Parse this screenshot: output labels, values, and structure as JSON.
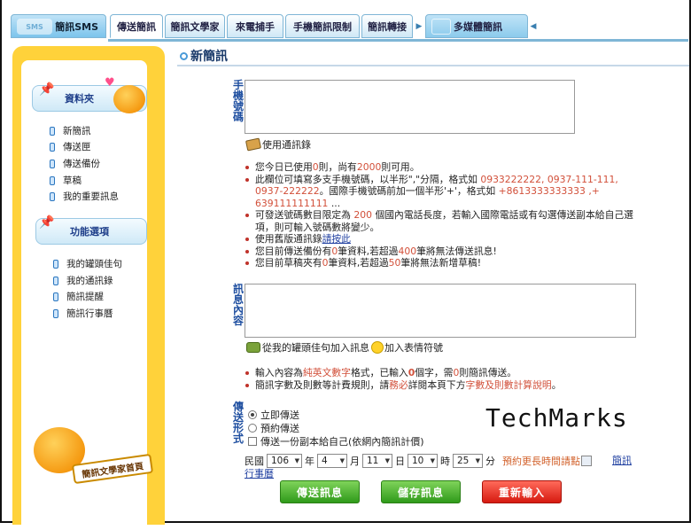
{
  "tabs": {
    "sms": "簡訊SMS",
    "sms_logo": "SMS",
    "items": [
      "傳送簡訊",
      "簡訊文學家",
      "來電捕手",
      "手機簡訊限制",
      "簡訊轉接"
    ],
    "mms": "多媒體簡訊"
  },
  "sidebar": {
    "folder_title": "資料夾",
    "folder_items": [
      "新簡訊",
      "傳送匣",
      "傳送備份",
      "草稿",
      "我的重要訊息"
    ],
    "options_title": "功能選項",
    "option_items": [
      "我的罐頭佳句",
      "我的通訊錄",
      "簡訊提醒",
      "簡訊行事曆"
    ],
    "badge": "簡訊文學家首頁"
  },
  "page": {
    "title": "新簡訊"
  },
  "phone": {
    "label": "手機號碼",
    "value": "",
    "contacts_link": "使用通訊錄",
    "info": {
      "l1a": "您今日已使用",
      "l1b": "0",
      "l1c": "則，尚有",
      "l1d": "2000",
      "l1e": "則可用。",
      "l2a": "此欄位可填寫多支手機號碼，以半形\",\"分隔，格式如 ",
      "l2b": "0933222222, 0937-111-111, 0937-222222",
      "l2c": "。國際手機號碼前加一個半形'+'，格式如 ",
      "l2d": "+8613333333333 ,+ 639111111111",
      "l2e": " ...",
      "l3a": "可發送號碼數目限定為 ",
      "l3b": "200",
      "l3c": " 個國內電話長度，若輸入國際電話或有勾選傳送副本給自己選項，則可輸入號碼數將變少。",
      "l4a": "使用舊版通訊錄",
      "l4b": "請按此",
      "l5a": "您目前傳送備份有",
      "l5b": "0",
      "l5c": "筆資料,若超過",
      "l5d": "400",
      "l5e": "筆將無法傳送訊息!",
      "l6a": "您目前草稿夾有",
      "l6b": "0",
      "l6c": "筆資料,若超過",
      "l6d": "50",
      "l6e": "筆將無法新增草稿!"
    }
  },
  "message": {
    "label": "訊息內容",
    "value": "",
    "phrase_link": "從我的罐頭佳句加入訊息",
    "emoji_link": "加入表情符號",
    "info": {
      "l1a": "輸入內容為",
      "l1b": "純英文數字",
      "l1c": "格式，已輸入",
      "l1d": "0",
      "l1e": "個字，需",
      "l1f": "0",
      "l1g": "則簡訊傳送。",
      "l2a": "簡訊字數及則數等計費規則，請",
      "l2b": "務必",
      "l2c": "詳閱本頁下方",
      "l2d": "字數及則數計算說明",
      "l2e": "。"
    }
  },
  "send": {
    "label": "傳送形式",
    "now": "立即傳送",
    "scheduled": "預約傳送",
    "copy": "傳送一份副本給自己(依網內簡訊計價)",
    "prefix": "民國",
    "year": "106",
    "year_unit": "年",
    "month": "4",
    "month_unit": "月",
    "day": "11",
    "day_unit": "日",
    "hour": "10",
    "hour_unit": "時",
    "minute": "25",
    "minute_unit": "分",
    "more_time": "預約更長時間請點",
    "calendar_link": "簡訊行事曆"
  },
  "buttons": {
    "send": "傳送訊息",
    "save": "儲存訊息",
    "reset": "重新輸入"
  },
  "watermark": "TechMarks"
}
